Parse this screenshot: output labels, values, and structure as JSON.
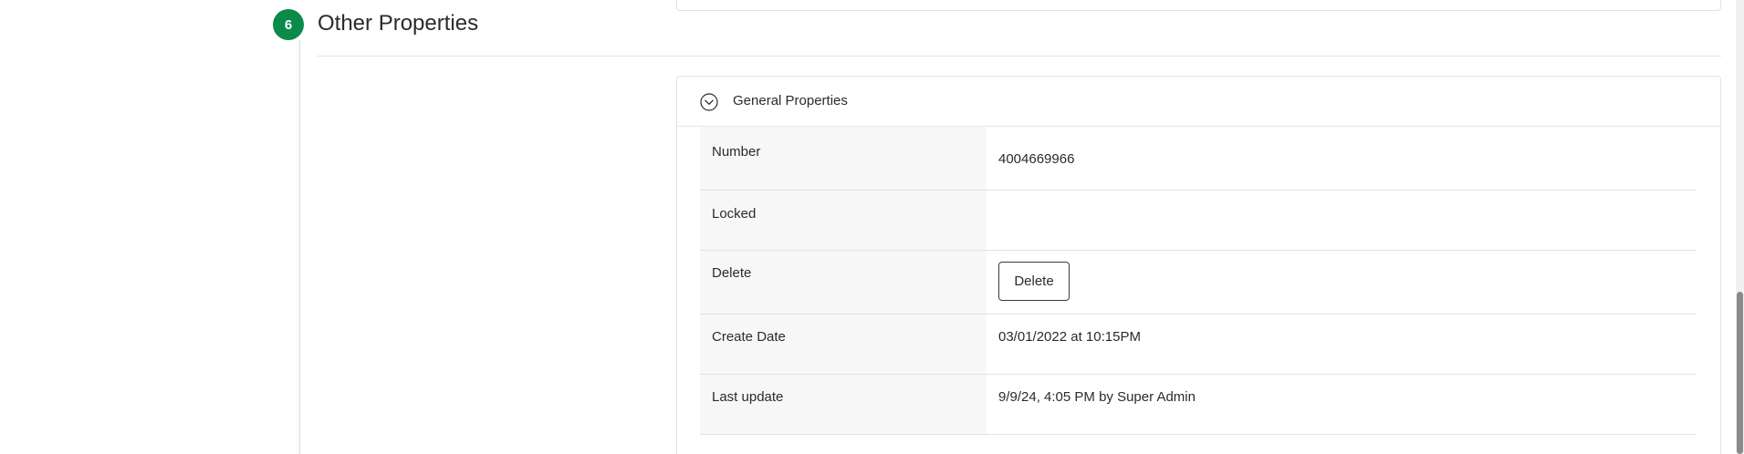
{
  "section": {
    "step_number": "6",
    "title": "Other Properties",
    "accent_color": "#0b8a4a"
  },
  "card": {
    "header_label": "General Properties",
    "toggle_icon": "chevron-down-circle-icon",
    "rows": [
      {
        "label": "Number",
        "value": "4004669966"
      },
      {
        "label": "Locked",
        "value": ""
      },
      {
        "label": "Delete",
        "button_label": "Delete"
      },
      {
        "label": "Create Date",
        "value": "03/01/2022 at 10:15PM"
      },
      {
        "label": "Last update",
        "value": "9/9/24, 4:05 PM by Super Admin"
      }
    ]
  }
}
